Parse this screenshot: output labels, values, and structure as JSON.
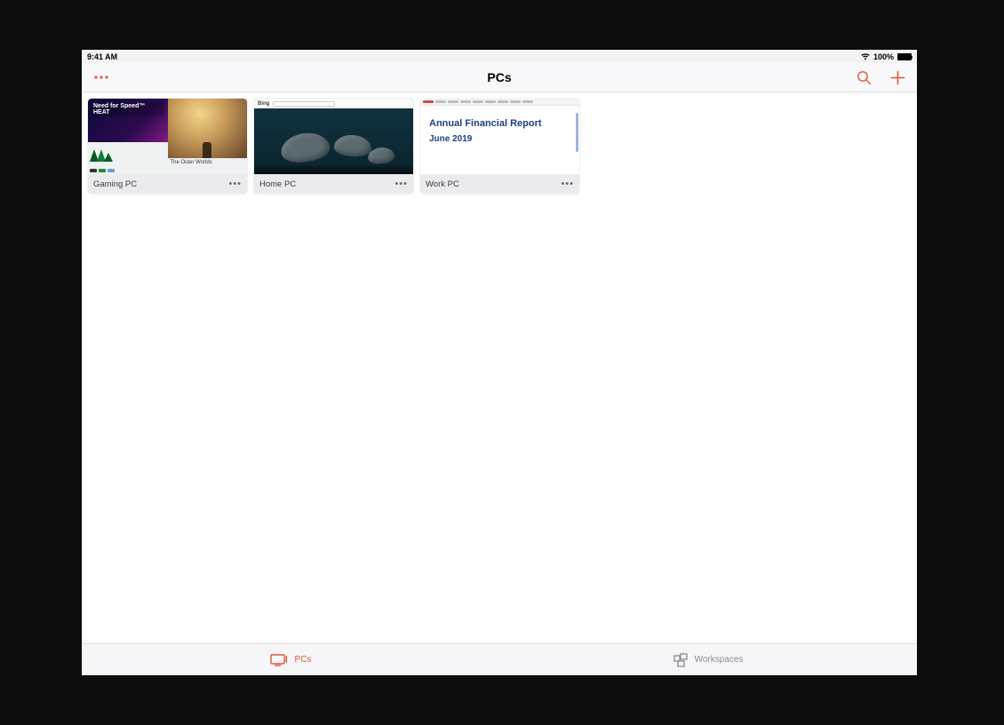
{
  "statusbar": {
    "time": "9:41 AM",
    "battery_pct": "100%"
  },
  "navbar": {
    "title": "PCs"
  },
  "cards": {
    "gaming": {
      "name": "Gaming PC",
      "nfs_title": "Need for Speed™ HEAT",
      "outer_worlds": "The Outer Worlds"
    },
    "home": {
      "name": "Home PC",
      "bing_label": "Bing"
    },
    "work": {
      "name": "Work PC",
      "doc_title": "Annual Financial Report",
      "doc_sub": "June 2019"
    }
  },
  "tabs": {
    "pcs": "PCs",
    "workspaces": "Workspaces"
  }
}
